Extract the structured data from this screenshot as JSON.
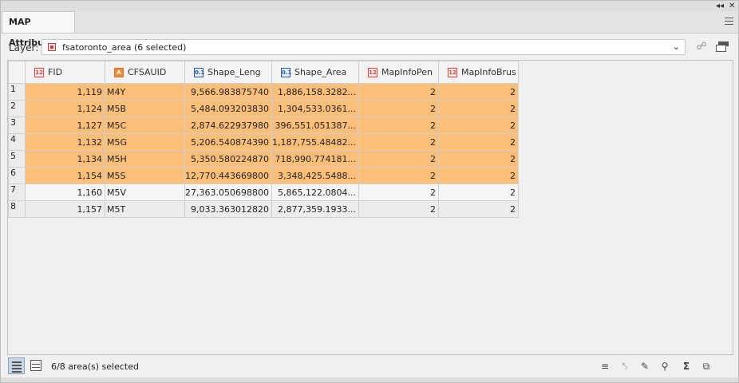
{
  "window": {
    "collapse_glyph": "◂◂",
    "close_glyph": "✕"
  },
  "tab": {
    "label": "MAP Attributes"
  },
  "layer": {
    "label": "Layer:",
    "value": "fsatoronto_area (6 selected)"
  },
  "table": {
    "columns": [
      {
        "label": "FID",
        "type_icon": "12",
        "icon_kind": "integer-field-icon"
      },
      {
        "label": "CFSAUID",
        "type_icon": "A",
        "icon_kind": "string-field-icon"
      },
      {
        "label": "Shape_Leng",
        "type_icon": "0.1",
        "icon_kind": "double-field-icon"
      },
      {
        "label": "Shape_Area",
        "type_icon": "0.1",
        "icon_kind": "double-field-icon"
      },
      {
        "label": "MapInfoPen",
        "type_icon": "12",
        "icon_kind": "integer-field-icon"
      },
      {
        "label": "MapInfoBrus",
        "type_icon": "12",
        "icon_kind": "integer-field-icon"
      }
    ],
    "rows": [
      {
        "n": "1",
        "selected": true,
        "cells": [
          "1,119",
          "M4Y",
          "9,566.983875740",
          "1,886,158.3282...",
          "2",
          "2"
        ]
      },
      {
        "n": "2",
        "selected": true,
        "cells": [
          "1,124",
          "M5B",
          "5,484.093203830",
          "1,304,533.0361...",
          "2",
          "2"
        ]
      },
      {
        "n": "3",
        "selected": true,
        "cells": [
          "1,127",
          "M5C",
          "2,874.622937980",
          "396,551.051387...",
          "2",
          "2"
        ]
      },
      {
        "n": "4",
        "selected": true,
        "cells": [
          "1,132",
          "M5G",
          "5,206.540874390",
          "1,187,755.48482...",
          "2",
          "2"
        ]
      },
      {
        "n": "5",
        "selected": true,
        "cells": [
          "1,134",
          "M5H",
          "5,350.580224870",
          "718,990.774181...",
          "2",
          "2"
        ]
      },
      {
        "n": "6",
        "selected": true,
        "cells": [
          "1,154",
          "M5S",
          "12,770.443669800",
          "3,348,425.5488...",
          "2",
          "2"
        ]
      },
      {
        "n": "7",
        "selected": false,
        "cells": [
          "1,160",
          "M5V",
          "27,363.050698800",
          "5,865,122.0804...",
          "2",
          "2"
        ]
      },
      {
        "n": "8",
        "selected": false,
        "cells": [
          "1,157",
          "M5T",
          "9,033.363012820",
          "2,877,359.1933...",
          "2",
          "2"
        ]
      }
    ]
  },
  "status": {
    "text": "6/8 area(s) selected"
  },
  "colors": {
    "selected_row": "#fbbf7a",
    "active_view": "#c9d6e6"
  }
}
